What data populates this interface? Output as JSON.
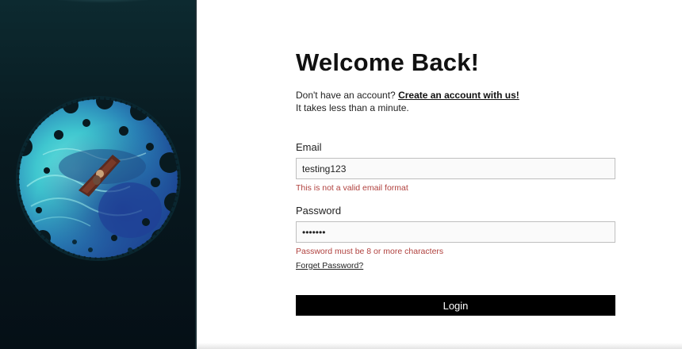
{
  "header": {
    "title": "Welcome Back!",
    "signup_prompt": "Don't have an account?",
    "signup_link": "Create an account with us!",
    "signup_note": "It takes less than a minute."
  },
  "form": {
    "email": {
      "label": "Email",
      "value": "testing123",
      "error": "This is not a valid email format"
    },
    "password": {
      "label": "Password",
      "value": "•••••••",
      "error": "Password must be 8 or more characters"
    },
    "forgot_label": "Forget Password?",
    "submit_label": "Login"
  },
  "colors": {
    "left_panel_bg": "#081a20",
    "error": "#b0413e",
    "button_bg": "#000000",
    "button_text": "#ffffff"
  },
  "icons": {
    "illustration": "ocean-boat-illustration"
  }
}
